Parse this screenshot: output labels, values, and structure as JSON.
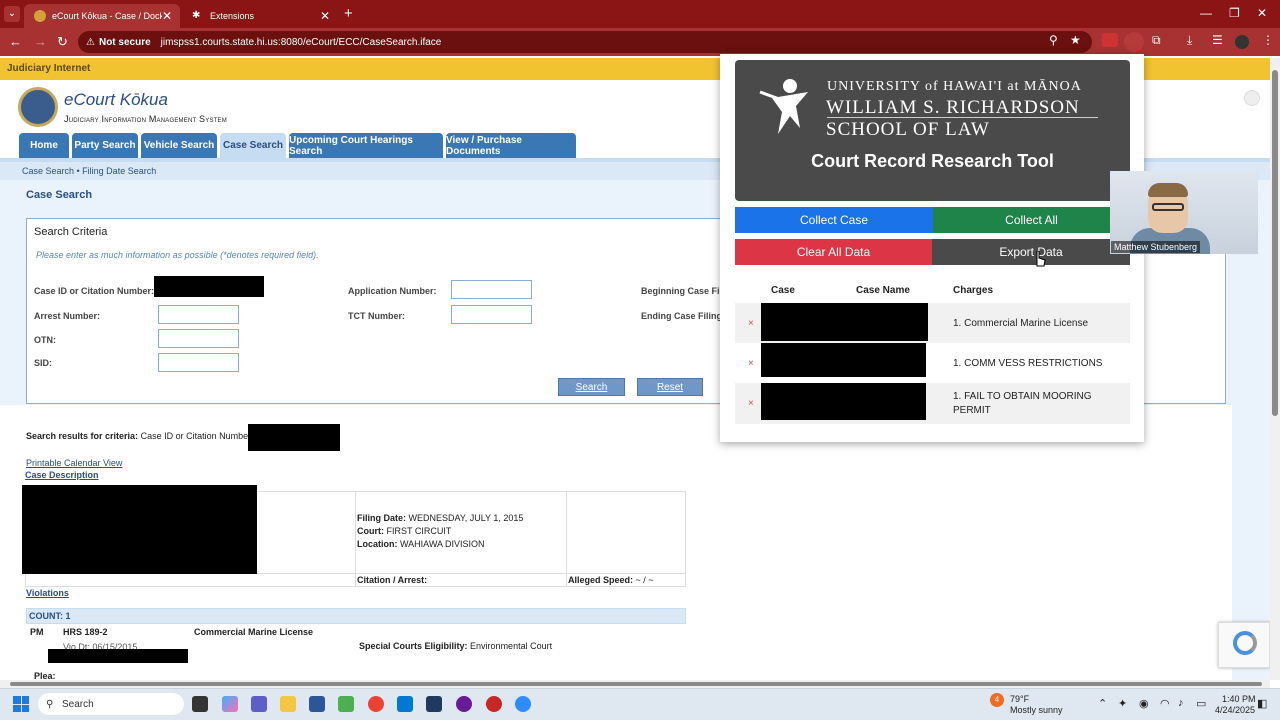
{
  "browser": {
    "tabs": [
      {
        "title": "eCourt Kōkua - Case / Docket S",
        "active": true
      },
      {
        "title": "Extensions",
        "active": false
      }
    ],
    "security": "Not secure",
    "url": "jimspss1.courts.state.hi.us:8080/eCourt/ECC/CaseSearch.iface"
  },
  "page": {
    "judiciary_bar": "Judiciary Internet",
    "brand": "eCourt Kōkua",
    "brand_sub": "Judiciary Information Management System",
    "nav": [
      "Home",
      "Party Search",
      "Vehicle Search",
      "Case Search",
      "Upcoming Court Hearings Search",
      "View / Purchase Documents"
    ],
    "breadcrumb": "Case Search • Filing Date Search",
    "title": "Case Search",
    "criteria": {
      "title": "Search Criteria",
      "note": "Please enter as much information as possible (*denotes required field).",
      "fields": {
        "case_id": "Case ID or Citation Number:",
        "arrest": "Arrest Number:",
        "otn": "OTN:",
        "sid": "SID:",
        "application": "Application Number:",
        "tct": "TCT Number:",
        "begin_date": "Beginning Case Fil",
        "end_date": "Ending Case Filing"
      },
      "search_btn": "Search",
      "reset_btn": "Reset"
    },
    "results": {
      "criteria_label": "Search results for criteria:",
      "criteria_value": "Case ID or Citation Number:",
      "calendar_link": "Printable Calendar View",
      "case_desc": "Case Description",
      "filing_date_label": "Filing Date:",
      "filing_date": "WEDNESDAY, JULY 1, 2015",
      "court_label": "Court:",
      "court": "FIRST CIRCUIT",
      "location_label": "Location:",
      "location": "WAHIAWA DIVISION",
      "citation_label": "Citation / Arrest:",
      "speed_label": "Alleged Speed:",
      "speed_value": "~ / ~",
      "violations": "Violations",
      "count": "COUNT: 1",
      "pm": "PM",
      "statute": "HRS 189-2",
      "charge": "Commercial Marine License",
      "vio_dt": "Vio Dt: 06/15/2015",
      "special_label": "Special Courts Eligibility:",
      "special_value": "Environmental Court",
      "plea": "Plea:"
    }
  },
  "extension": {
    "uh_line": "UNIVERSITY of HAWAI'I at MĀNOA",
    "law_line1": "WILLIAM S. RICHARDSON",
    "law_line2": "SCHOOL OF LAW",
    "title": "Court Record Research Tool",
    "buttons": {
      "collect_case": "Collect Case",
      "collect_all": "Collect All",
      "clear_all": "Clear All Data",
      "export": "Export Data"
    },
    "columns": [
      "Case",
      "Case Name",
      "Charges"
    ],
    "rows": [
      {
        "remove": "×",
        "charge": "1. Commercial Marine License"
      },
      {
        "remove": "×",
        "charge": "1. COMM VESS RESTRICTIONS"
      },
      {
        "remove": "×",
        "charge": "1. FAIL TO OBTAIN MOORING PERMIT"
      }
    ],
    "colors": {
      "collect_case": "#1a73e8",
      "collect_all": "#1e8449",
      "clear_all": "#dc3545",
      "export": "#4a4a4a"
    }
  },
  "webcam": {
    "name": "Matthew Stubenberg"
  },
  "taskbar": {
    "search": "Search",
    "weather_temp": "79°F",
    "weather_desc": "Mostly sunny",
    "weather_badge": "4",
    "time": "1:40 PM",
    "date": "4/24/2025"
  }
}
